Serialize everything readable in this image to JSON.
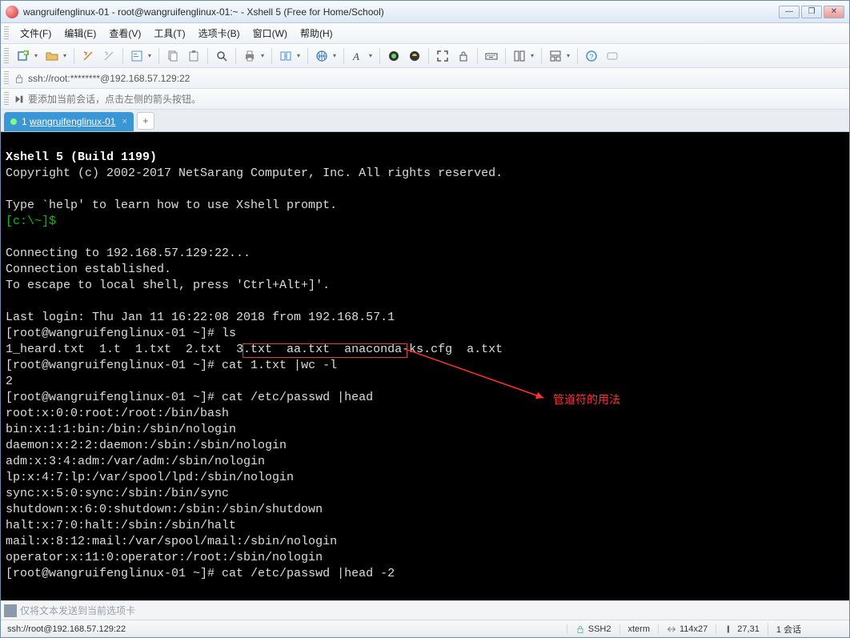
{
  "window": {
    "title": "wangruifenglinux-01 - root@wangruifenglinux-01:~ - Xshell 5 (Free for Home/School)"
  },
  "menu": {
    "file": "文件(F)",
    "edit": "编辑(E)",
    "view": "查看(V)",
    "tools": "工具(T)",
    "tabs": "选项卡(B)",
    "window": "窗口(W)",
    "help": "帮助(H)"
  },
  "address": {
    "url": "ssh://root:********@192.168.57.129:22"
  },
  "infobar": {
    "hint": "要添加当前会话，点击左侧的箭头按钮。"
  },
  "tab": {
    "index": "1",
    "label": "wangruifenglinux-01",
    "add": "+"
  },
  "terminal": {
    "line1": "Xshell 5 (Build 1199)",
    "line2": "Copyright (c) 2002-2017 NetSarang Computer, Inc. All rights reserved.",
    "line3": "Type `help' to learn how to use Xshell prompt.",
    "prompt_local": "[c:\\~]$",
    "line4": "Connecting to 192.168.57.129:22...",
    "line5": "Connection established.",
    "line6": "To escape to local shell, press 'Ctrl+Alt+]'.",
    "line7": "Last login: Thu Jan 11 16:22:08 2018 from 192.168.57.1",
    "prompt_remote": "[root@wangruifenglinux-01 ~]# ",
    "cmd1": "ls",
    "ls_out": "1_heard.txt  1.t  1.txt  2.txt  3.txt  aa.txt  anaconda-ks.cfg  a.txt",
    "cmd2": "cat 1.txt |wc -l",
    "cmd2_out": "2",
    "cmd3": "cat /etc/passwd |head",
    "passwd": [
      "root:x:0:0:root:/root:/bin/bash",
      "bin:x:1:1:bin:/bin:/sbin/nologin",
      "daemon:x:2:2:daemon:/sbin:/sbin/nologin",
      "adm:x:3:4:adm:/var/adm:/sbin/nologin",
      "lp:x:4:7:lp:/var/spool/lpd:/sbin/nologin",
      "sync:x:5:0:sync:/sbin:/bin/sync",
      "shutdown:x:6:0:shutdown:/sbin:/sbin/shutdown",
      "halt:x:7:0:halt:/sbin:/sbin/halt",
      "mail:x:8:12:mail:/var/spool/mail:/sbin/nologin",
      "operator:x:11:0:operator:/root:/sbin/nologin"
    ],
    "cmd4": "cat /etc/passwd |head -2"
  },
  "annotation": {
    "text": "管道符的用法"
  },
  "inputbar": {
    "hint": "仅将文本发送到当前选项卡"
  },
  "status": {
    "left": "ssh://root@192.168.57.129:22",
    "proto": "SSH2",
    "term": "xterm",
    "size": "114x27",
    "pos": "27,31",
    "sessions": "1 会话"
  }
}
